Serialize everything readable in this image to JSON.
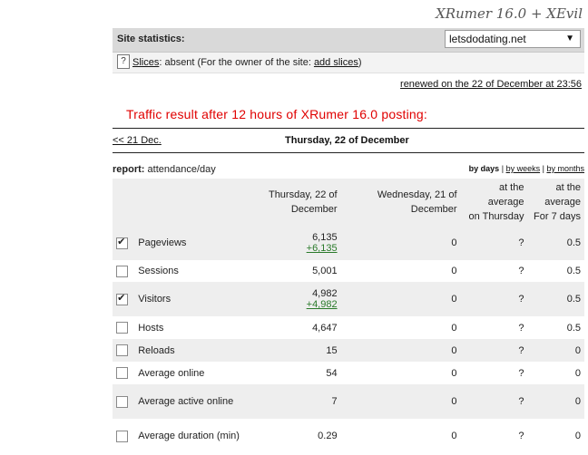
{
  "brand": "XRumer 16.0 + XEvil",
  "stats_bar": {
    "label": "Site statistics:",
    "site": "letsdodating.net"
  },
  "slices": {
    "link": "Slices",
    "text": ": absent (For the owner of the site: ",
    "add_link": "add slices",
    "close": ")"
  },
  "renewed": "renewed on the 22 of December at 23:56",
  "headline": "Traffic result after 12 hours of XRumer 16.0 posting:",
  "day_nav": {
    "prev": "<< 21 Dec.",
    "current": "Thursday, 22 of December"
  },
  "report": {
    "label": "report:",
    "value": "attendance/day"
  },
  "periods": {
    "days": "by days",
    "sep": "|",
    "weeks": "by weeks",
    "months": "by months"
  },
  "table": {
    "headers": {
      "today": [
        "Thursday, 22 of",
        "December"
      ],
      "yesterday": [
        "Wednesday, 21 of",
        "December"
      ],
      "avg_day": [
        "at the",
        "average",
        "on Thursday"
      ],
      "avg_week": [
        "at the",
        "average",
        "For 7 days"
      ]
    },
    "rows": [
      {
        "checked": true,
        "name": "Pageviews",
        "today": "6,135",
        "delta": "+6,135",
        "yesterday": "0",
        "avg_day": "?",
        "avg_week": "0.5"
      },
      {
        "checked": false,
        "name": "Sessions",
        "today": "5,001",
        "delta": "",
        "yesterday": "0",
        "avg_day": "?",
        "avg_week": "0.5"
      },
      {
        "checked": true,
        "name": "Visitors",
        "today": "4,982",
        "delta": "+4,982",
        "yesterday": "0",
        "avg_day": "?",
        "avg_week": "0.5"
      },
      {
        "checked": false,
        "name": "Hosts",
        "today": "4,647",
        "delta": "",
        "yesterday": "0",
        "avg_day": "?",
        "avg_week": "0.5"
      },
      {
        "checked": false,
        "name": "Reloads",
        "today": "15",
        "delta": "",
        "yesterday": "0",
        "avg_day": "?",
        "avg_week": "0"
      },
      {
        "checked": false,
        "name": "Average online",
        "today": "54",
        "delta": "",
        "yesterday": "0",
        "avg_day": "?",
        "avg_week": "0"
      },
      {
        "checked": false,
        "name": "Average active online",
        "today": "7",
        "delta": "",
        "yesterday": "0",
        "avg_day": "?",
        "avg_week": "0"
      },
      {
        "checked": false,
        "name": "Average duration (min)",
        "today": "0.29",
        "delta": "",
        "yesterday": "0",
        "avg_day": "?",
        "avg_week": "0"
      }
    ]
  }
}
